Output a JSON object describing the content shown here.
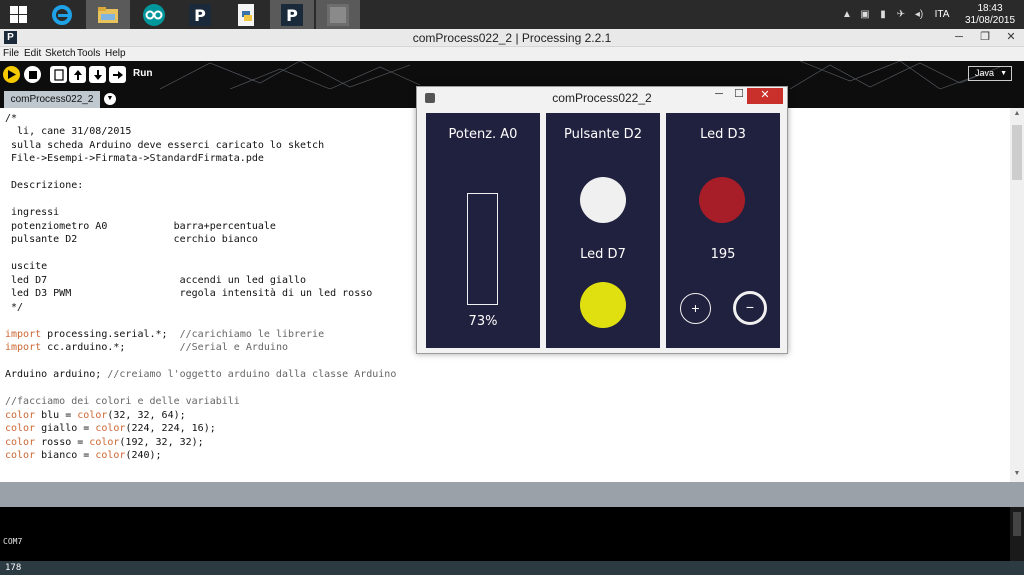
{
  "taskbar": {
    "start_icon": "windows-logo-icon",
    "apps": [
      {
        "name": "internet-explorer-icon",
        "color": "#1ea1e6"
      },
      {
        "name": "file-explorer-icon",
        "color": "#e8c25c"
      },
      {
        "name": "arduino-icon",
        "color": "#00979c"
      },
      {
        "name": "processing-icon",
        "color": "#1b2a3a"
      },
      {
        "name": "python-document-icon",
        "color": "#3a74a8"
      },
      {
        "name": "processing-icon",
        "color": "#1b2a3a"
      },
      {
        "name": "sketch-window-icon",
        "color": "#6d6d6d"
      }
    ],
    "language": "ITA",
    "time": "18:43",
    "date": "31/08/2015"
  },
  "ide": {
    "window_title": "comProcess022_2 | Processing 2.2.1",
    "app_badge": "P",
    "menu": [
      "File",
      "Edit",
      "Sketch",
      "Tools",
      "Help"
    ],
    "run_label": "Run",
    "mode": "Java",
    "tab_label": "comProcess022_2",
    "line_number": "178",
    "console_text": "COM7"
  },
  "code_lines": [
    "/*",
    "  li, cane 31/08/2015",
    " sulla scheda Arduino deve esserci caricato lo sketch",
    " File->Esempi->Firmata->StandardFirmata.pde",
    "",
    " Descrizione:",
    "",
    " ingressi",
    " potenziometro A0           barra+percentuale",
    " pulsante D2                cerchio bianco",
    "",
    " uscite",
    " led D7                      accendi un led giallo",
    " led D3 PWM                  regola intensità di un led rosso",
    " */",
    "",
    "import processing.serial.*;  //carichiamo le librerie",
    "import cc.arduino.*;         //Serial e Arduino",
    "",
    "Arduino arduino; //creiamo l'oggetto arduino dalla classe Arduino",
    "",
    "//facciamo dei colori e delle variabili",
    "color blu = color(32, 32, 64);",
    "color giallo = color(224, 224, 16);",
    "color rosso = color(192, 32, 32);",
    "color bianco = color(240);"
  ],
  "sketch": {
    "window_title": "comProcess022_2",
    "colors": {
      "panel": "#20203f",
      "white": "#f0f0f0",
      "yellow": "#e0e010",
      "red": "#a81e28"
    },
    "panel_a0": {
      "title": "Potenz. A0",
      "percent_label": "73%",
      "level_percent": 73
    },
    "panel_d2": {
      "title": "Pulsante D2",
      "led_title": "Led D7"
    },
    "panel_d3": {
      "title": "Led D3",
      "pwm_value": "195",
      "plus": "+",
      "minus": "−"
    }
  }
}
